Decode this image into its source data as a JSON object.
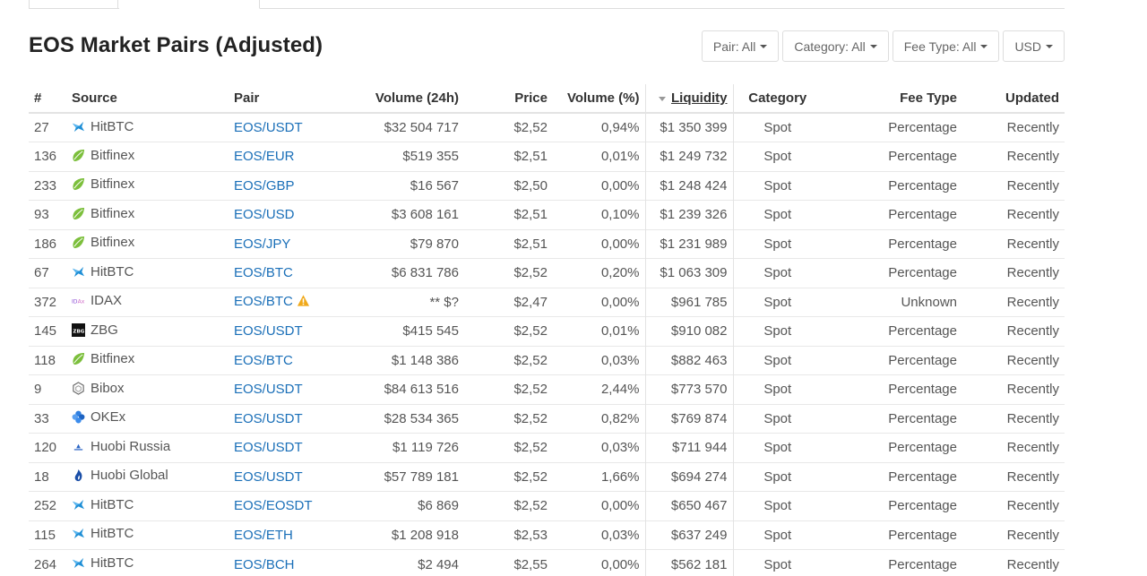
{
  "page": {
    "title": "EOS Market Pairs (Adjusted)"
  },
  "filters": [
    {
      "label": "Pair: All"
    },
    {
      "label": "Category: All"
    },
    {
      "label": "Fee Type: All"
    },
    {
      "label": "USD"
    }
  ],
  "columns": {
    "rank": "#",
    "source": "Source",
    "pair": "Pair",
    "volume": "Volume (24h)",
    "price": "Price",
    "volume_pct": "Volume (%)",
    "liquidity": "Liquidity",
    "category": "Category",
    "fee_type": "Fee Type",
    "updated": "Updated"
  },
  "rows": [
    {
      "rank": "27",
      "source": "HitBTC",
      "icon": "hitbtc-icon",
      "pair": "EOS/USDT",
      "volume": "$32 504 717",
      "price": "$2,52",
      "volume_pct": "0,94%",
      "liquidity": "$1 350 399",
      "category": "Spot",
      "fee_type": "Percentage",
      "updated": "Recently"
    },
    {
      "rank": "136",
      "source": "Bitfinex",
      "icon": "bitfinex-icon",
      "pair": "EOS/EUR",
      "volume": "$519 355",
      "price": "$2,51",
      "volume_pct": "0,01%",
      "liquidity": "$1 249 732",
      "category": "Spot",
      "fee_type": "Percentage",
      "updated": "Recently"
    },
    {
      "rank": "233",
      "source": "Bitfinex",
      "icon": "bitfinex-icon",
      "pair": "EOS/GBP",
      "volume": "$16 567",
      "price": "$2,50",
      "volume_pct": "0,00%",
      "liquidity": "$1 248 424",
      "category": "Spot",
      "fee_type": "Percentage",
      "updated": "Recently"
    },
    {
      "rank": "93",
      "source": "Bitfinex",
      "icon": "bitfinex-icon",
      "pair": "EOS/USD",
      "volume": "$3 608 161",
      "price": "$2,51",
      "volume_pct": "0,10%",
      "liquidity": "$1 239 326",
      "category": "Spot",
      "fee_type": "Percentage",
      "updated": "Recently"
    },
    {
      "rank": "186",
      "source": "Bitfinex",
      "icon": "bitfinex-icon",
      "pair": "EOS/JPY",
      "volume": "$79 870",
      "price": "$2,51",
      "volume_pct": "0,00%",
      "liquidity": "$1 231 989",
      "category": "Spot",
      "fee_type": "Percentage",
      "updated": "Recently"
    },
    {
      "rank": "67",
      "source": "HitBTC",
      "icon": "hitbtc-icon",
      "pair": "EOS/BTC",
      "volume": "$6 831 786",
      "price": "$2,52",
      "volume_pct": "0,20%",
      "liquidity": "$1 063 309",
      "category": "Spot",
      "fee_type": "Percentage",
      "updated": "Recently"
    },
    {
      "rank": "372",
      "source": "IDAX",
      "icon": "idax-icon",
      "pair": "EOS/BTC",
      "volume": "** $?",
      "price": "$2,47",
      "volume_pct": "0,00%",
      "liquidity": "$961 785",
      "category": "Spot",
      "fee_type": "Unknown",
      "updated": "Recently",
      "warning": true
    },
    {
      "rank": "145",
      "source": "ZBG",
      "icon": "zbg-icon",
      "pair": "EOS/USDT",
      "volume": "$415 545",
      "price": "$2,52",
      "volume_pct": "0,01%",
      "liquidity": "$910 082",
      "category": "Spot",
      "fee_type": "Percentage",
      "updated": "Recently"
    },
    {
      "rank": "118",
      "source": "Bitfinex",
      "icon": "bitfinex-icon",
      "pair": "EOS/BTC",
      "volume": "$1 148 386",
      "price": "$2,52",
      "volume_pct": "0,03%",
      "liquidity": "$882 463",
      "category": "Spot",
      "fee_type": "Percentage",
      "updated": "Recently"
    },
    {
      "rank": "9",
      "source": "Bibox",
      "icon": "bibox-icon",
      "pair": "EOS/USDT",
      "volume": "$84 613 516",
      "price": "$2,52",
      "volume_pct": "2,44%",
      "liquidity": "$773 570",
      "category": "Spot",
      "fee_type": "Percentage",
      "updated": "Recently"
    },
    {
      "rank": "33",
      "source": "OKEx",
      "icon": "okex-icon",
      "pair": "EOS/USDT",
      "volume": "$28 534 365",
      "price": "$2,52",
      "volume_pct": "0,82%",
      "liquidity": "$769 874",
      "category": "Spot",
      "fee_type": "Percentage",
      "updated": "Recently"
    },
    {
      "rank": "120",
      "source": "Huobi Russia",
      "icon": "huobi-russia-icon",
      "pair": "EOS/USDT",
      "volume": "$1 119 726",
      "price": "$2,52",
      "volume_pct": "0,03%",
      "liquidity": "$711 944",
      "category": "Spot",
      "fee_type": "Percentage",
      "updated": "Recently"
    },
    {
      "rank": "18",
      "source": "Huobi Global",
      "icon": "huobi-global-icon",
      "pair": "EOS/USDT",
      "volume": "$57 789 181",
      "price": "$2,52",
      "volume_pct": "1,66%",
      "liquidity": "$694 274",
      "category": "Spot",
      "fee_type": "Percentage",
      "updated": "Recently"
    },
    {
      "rank": "252",
      "source": "HitBTC",
      "icon": "hitbtc-icon",
      "pair": "EOS/EOSDT",
      "volume": "$6 869",
      "price": "$2,52",
      "volume_pct": "0,00%",
      "liquidity": "$650 467",
      "category": "Spot",
      "fee_type": "Percentage",
      "updated": "Recently"
    },
    {
      "rank": "115",
      "source": "HitBTC",
      "icon": "hitbtc-icon",
      "pair": "EOS/ETH",
      "volume": "$1 208 918",
      "price": "$2,53",
      "volume_pct": "0,03%",
      "liquidity": "$637 249",
      "category": "Spot",
      "fee_type": "Percentage",
      "updated": "Recently"
    },
    {
      "rank": "264",
      "source": "HitBTC",
      "icon": "hitbtc-icon",
      "pair": "EOS/BCH",
      "volume": "$2 494",
      "price": "$2,55",
      "volume_pct": "0,00%",
      "liquidity": "$562 181",
      "category": "Spot",
      "fee_type": "Percentage",
      "updated": "Recently"
    }
  ],
  "colors": {
    "link": "#1a6fb8",
    "bitfinex": "#7cbf3c",
    "hitbtc": "#1f8fd6",
    "okex": "#2f7fe0",
    "warning": "#f0a91a"
  }
}
